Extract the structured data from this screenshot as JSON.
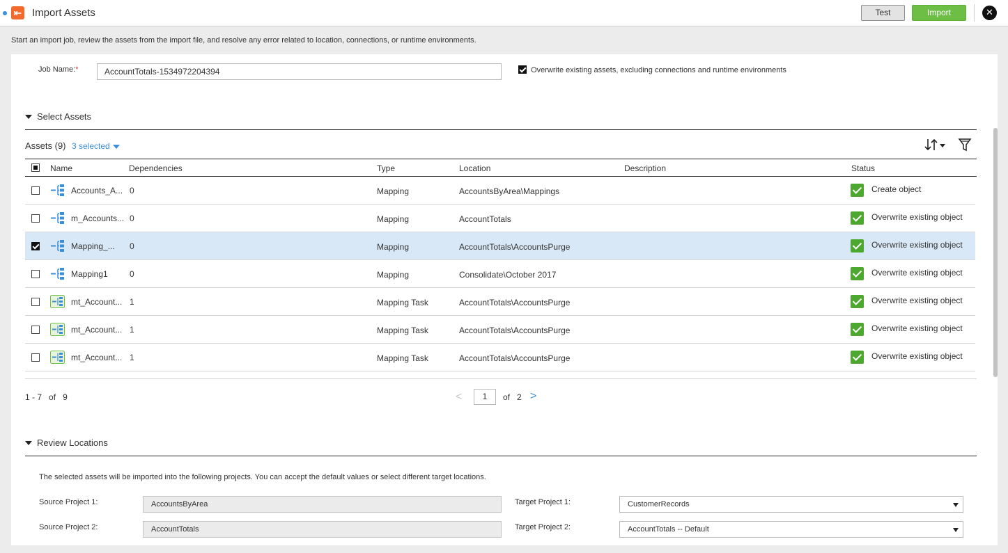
{
  "header": {
    "title": "Import Assets",
    "test_label": "Test",
    "import_label": "Import",
    "close_glyph": "✕",
    "logo_glyph": "⇤"
  },
  "intro": "Start an import job, review the assets from the import file, and resolve any error related to location, connections, or runtime environments.",
  "job": {
    "label": "Job Name:",
    "required_mark": "*",
    "value": "AccountTotals-1534972204394",
    "overwrite_checked": true,
    "overwrite_label": "Overwrite existing assets, excluding connections and runtime environments"
  },
  "select_assets": {
    "title": "Select Assets",
    "count_label": "Assets (9)",
    "selected_label": "3 selected",
    "columns": [
      "Name",
      "Dependencies",
      "Type",
      "Location",
      "Description",
      "Status"
    ],
    "rows": [
      {
        "name": "Accounts_A...",
        "deps": "0",
        "type": "Mapping",
        "location": "AccountsByArea\\Mappings",
        "description": "",
        "status": "Create object",
        "checked": false,
        "icon": "mapping-icon"
      },
      {
        "name": "m_Accounts...",
        "deps": "0",
        "type": "Mapping",
        "location": "AccountTotals",
        "description": "",
        "status": "Overwrite existing object",
        "checked": false,
        "icon": "mapping-icon"
      },
      {
        "name": "Mapping_...",
        "deps": "0",
        "type": "Mapping",
        "location": "AccountTotals\\AccountsPurge",
        "description": "",
        "status": "Overwrite existing object",
        "checked": true,
        "icon": "mapping-icon"
      },
      {
        "name": "Mapping1",
        "deps": "0",
        "type": "Mapping",
        "location": "Consolidate\\October 2017",
        "description": "",
        "status": "Overwrite existing object",
        "checked": false,
        "icon": "mapping-icon"
      },
      {
        "name": "mt_Account...",
        "deps": "1",
        "type": "Mapping Task",
        "location": "AccountTotals\\AccountsPurge",
        "description": "",
        "status": "Overwrite existing object",
        "checked": false,
        "icon": "mapping-task-icon"
      },
      {
        "name": "mt_Account...",
        "deps": "1",
        "type": "Mapping Task",
        "location": "AccountTotals\\AccountsPurge",
        "description": "",
        "status": "Overwrite existing object",
        "checked": false,
        "icon": "mapping-task-icon"
      },
      {
        "name": "mt_Account...",
        "deps": "1",
        "type": "Mapping Task",
        "location": "AccountTotals\\AccountsPurge",
        "description": "",
        "status": "Overwrite existing object",
        "checked": false,
        "icon": "mapping-task-icon"
      }
    ],
    "pagination": {
      "range_label": "1 - 7",
      "of_label": "of",
      "total": "9",
      "current_page": "1",
      "of_pages_label": "of",
      "total_pages": "2",
      "prev_glyph": "<",
      "next_glyph": ">"
    }
  },
  "review_locations": {
    "title": "Review Locations",
    "description": "The selected assets will be imported into the following projects. You can accept the default values or select different target locations.",
    "source_project_1_label": "Source Project 1:",
    "source_project_1": "AccountsByArea",
    "source_project_2_label": "Source Project 2:",
    "source_project_2": "AccountTotals",
    "target_project_1_label": "Target Project 1:",
    "target_project_1": "CustomerRecords",
    "target_project_2_label": "Target Project 2:",
    "target_project_2": "AccountTotals -- Default"
  },
  "colors": {
    "accent": "#3a8fd9",
    "import_button": "#6dbe45",
    "status_ok": "#4ca82f",
    "selected_row": "#d9e8f6",
    "logo": "#f26b2d"
  }
}
